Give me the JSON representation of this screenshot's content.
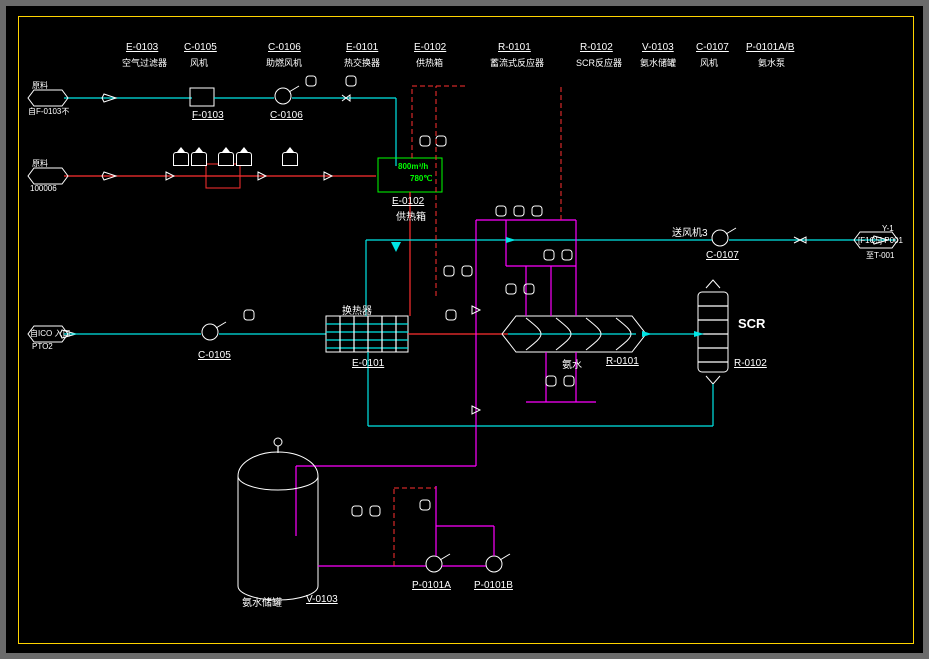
{
  "header": [
    {
      "tag": "E-0103",
      "name": "空气过滤器"
    },
    {
      "tag": "C-0105",
      "name": "风机"
    },
    {
      "tag": "C-0106",
      "name": "助燃风机"
    },
    {
      "tag": "E-0101",
      "name": "热交换器"
    },
    {
      "tag": "E-0102",
      "name": "供热箱"
    },
    {
      "tag": "R-0101",
      "name": "蓄流式反应器"
    },
    {
      "tag": "R-0102",
      "name": "SCR反应器"
    },
    {
      "tag": "V-0103",
      "name": "氨水储罐"
    },
    {
      "tag": "C-0107",
      "name": "风机"
    },
    {
      "tag": "P-0101A/B",
      "name": "氨水泵"
    }
  ],
  "equip_labels": {
    "F0103": "F-0103",
    "C0106": "C-0106",
    "E0102": "E-0102",
    "E0102cn": "供热箱",
    "C0107": "C-0107",
    "sendFan": "送风机3",
    "C0105": "C-0105",
    "E0101": "E-0101",
    "hexcn": "换热器",
    "R0101": "R-0101",
    "ammonia": "氨水",
    "R0102": "R-0102",
    "SCR": "SCR",
    "V0103": "V-0103",
    "tankcn": "氨水储罐",
    "P0101A": "P-0101A",
    "P0101B": "P-0101B"
  },
  "supply_box": {
    "flow": "800m³/h",
    "temp": "780℃"
  },
  "stream_labels": {
    "in1a": "原料",
    "in1b": "自F-0103不",
    "in2a": "原料",
    "in2b": "100006",
    "in3a": "自ICO 入口",
    "in3b": "PTO2",
    "out1a": "Y-1",
    "out1b": "[F1C5] P001",
    "out1c": "至T-001"
  },
  "colors": {
    "cyan": "#00e5e5",
    "magenta": "#ff00ff",
    "red": "#ff3030",
    "green": "#00ff00",
    "yellow": "#ffd400"
  }
}
